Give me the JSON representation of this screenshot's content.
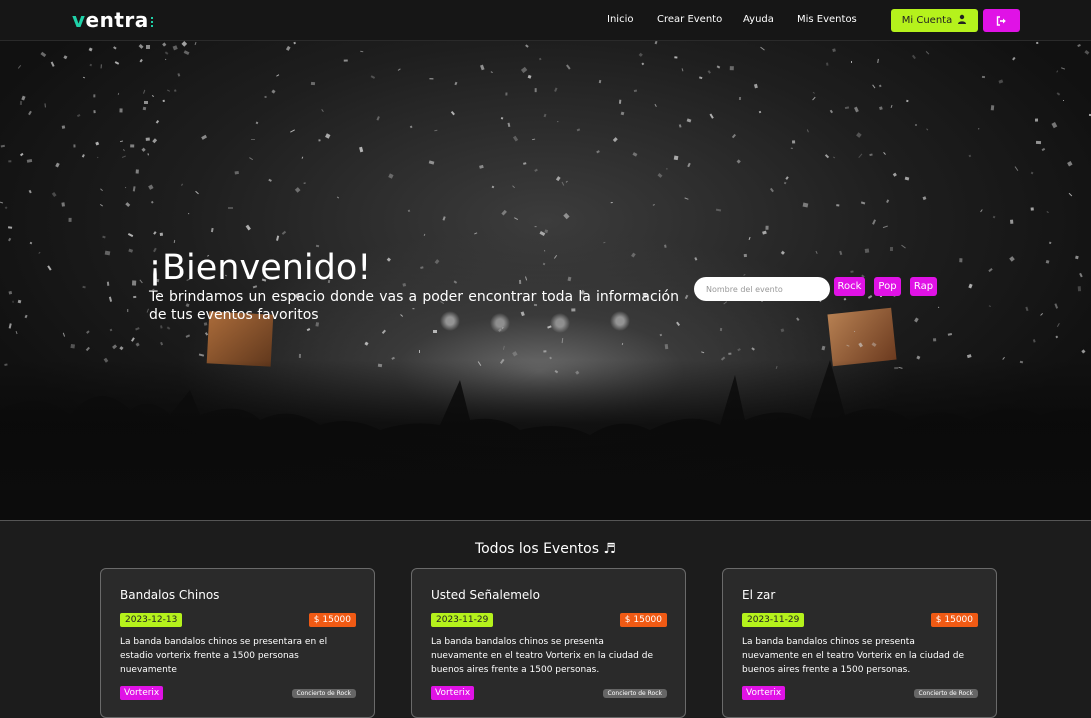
{
  "brand": {
    "logo_first": "v",
    "logo_rest": "entra"
  },
  "nav": {
    "links": [
      {
        "label": "Inicio"
      },
      {
        "label": "Crear Evento"
      },
      {
        "label": "Ayuda"
      },
      {
        "label": "Mis Eventos"
      }
    ],
    "account_label": "Mi Cuenta",
    "account_icon": "user-icon",
    "logout_icon": "logout-icon"
  },
  "hero": {
    "title": "¡Bienvenido!",
    "subtitle": "Te brindamos un espacio donde vas a poder encontrar toda la información de tus eventos favoritos",
    "search_placeholder": "Nombre del evento",
    "genres": [
      {
        "label": "Rock"
      },
      {
        "label": "Pop"
      },
      {
        "label": "Rap"
      }
    ]
  },
  "events": {
    "title": "Todos los Eventos ♬",
    "cards": [
      {
        "title": "Bandalos Chinos",
        "date": "2023-12-13",
        "price": "$ 15000",
        "description": "La banda bandalos chinos se presentara en el estadio vorterix frente a 1500 personas nuevamente",
        "venue": "Vorterix",
        "category": "Concierto de Rock"
      },
      {
        "title": "Usted Señalemelo",
        "date": "2023-11-29",
        "price": "$ 15000",
        "description": "La banda bandalos chinos se presenta nuevamente en el teatro Vorterix en la ciudad de buenos aires frente a 1500 personas.",
        "venue": "Vorterix",
        "category": "Concierto de Rock"
      },
      {
        "title": "El zar",
        "date": "2023-11-29",
        "price": "$ 15000",
        "description": "La banda bandalos chinos se presenta nuevamente en el teatro Vorterix en la ciudad de buenos aires frente a 1500 personas.",
        "venue": "Vorterix",
        "category": "Concierto de Rock"
      }
    ]
  },
  "colors": {
    "accent_green": "#b5f21c",
    "accent_magenta": "#e012e6",
    "accent_orange": "#f05a14",
    "logo_teal": "#1fd1a8"
  }
}
